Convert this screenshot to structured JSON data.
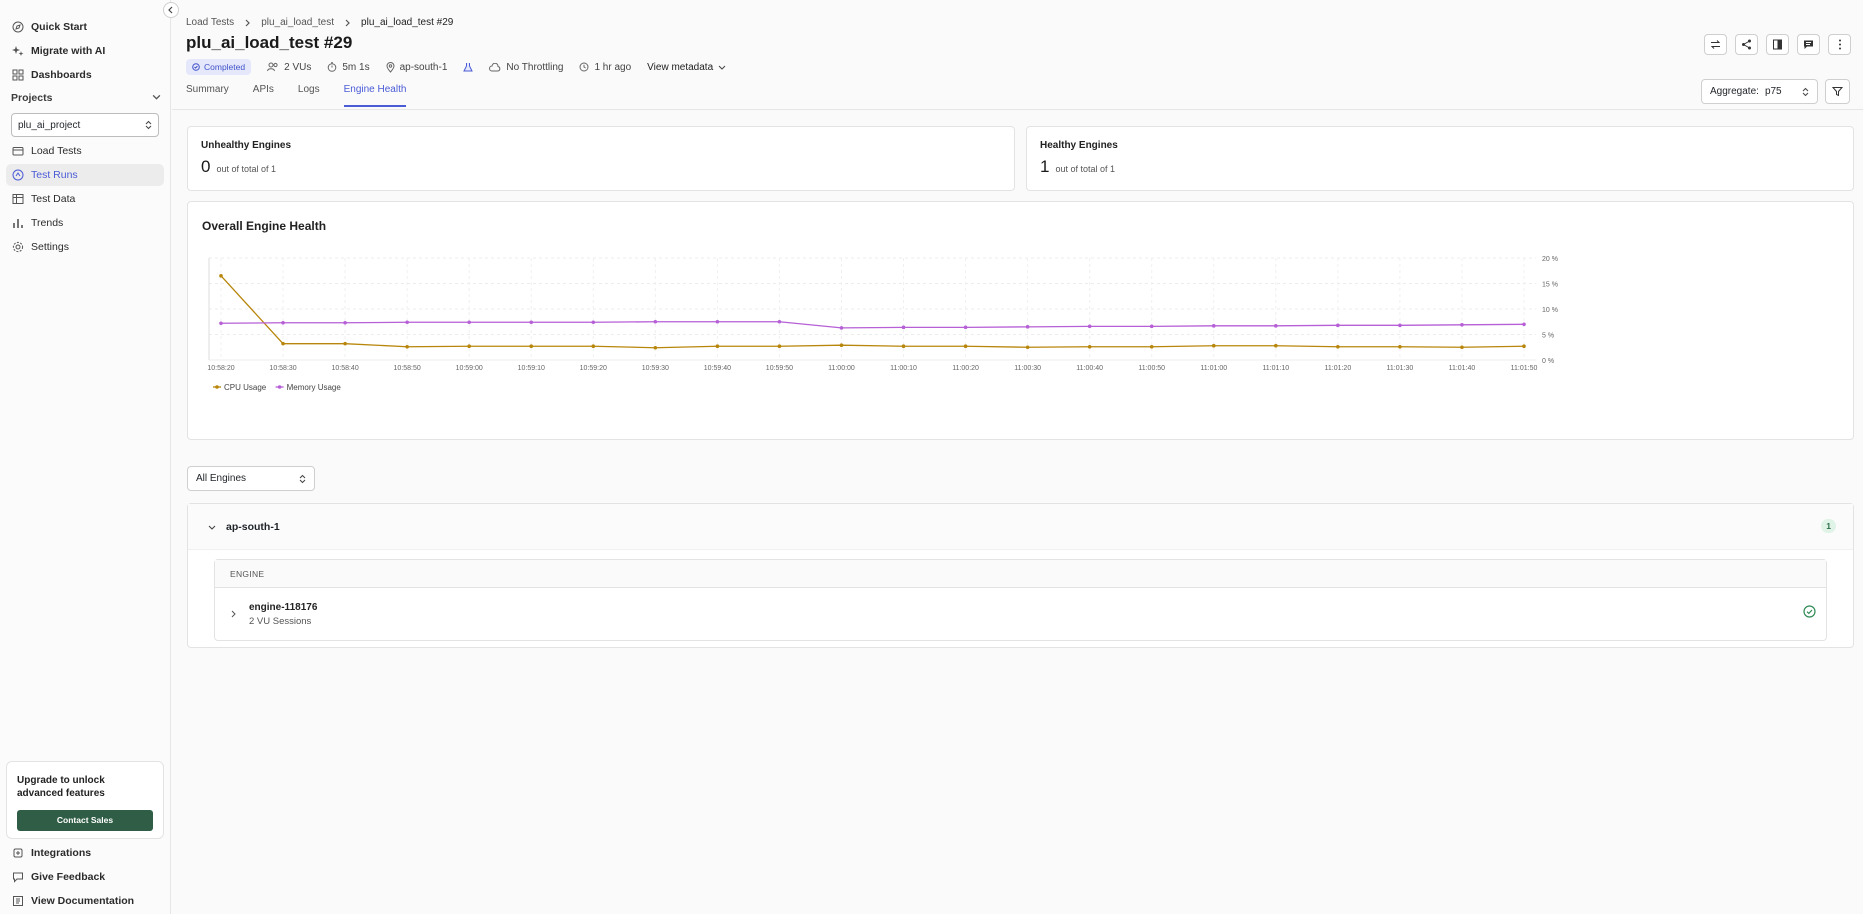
{
  "sidebar": {
    "top_items": [
      {
        "label": "Quick Start",
        "icon": "compass-icon"
      },
      {
        "label": "Migrate with AI",
        "icon": "sparkle-icon"
      },
      {
        "label": "Dashboards",
        "icon": "grid-icon"
      }
    ],
    "projects_label": "Projects",
    "project_selected": "plu_ai_project",
    "project_items": [
      {
        "label": "Load Tests",
        "icon": "folder-icon"
      },
      {
        "label": "Test Runs",
        "icon": "runs-icon",
        "active": true
      },
      {
        "label": "Test Data",
        "icon": "table-icon"
      },
      {
        "label": "Trends",
        "icon": "bar-chart-icon"
      },
      {
        "label": "Settings",
        "icon": "gear-icon"
      }
    ],
    "upgrade_text": "Upgrade to unlock advanced features",
    "contact_label": "Contact Sales",
    "bottom_items": [
      {
        "label": "Integrations",
        "icon": "plug-icon"
      },
      {
        "label": "Give Feedback",
        "icon": "feedback-icon"
      },
      {
        "label": "View Documentation",
        "icon": "doc-icon"
      }
    ]
  },
  "breadcrumb": [
    "Load Tests",
    "plu_ai_load_test",
    "plu_ai_load_test #29"
  ],
  "title": "plu_ai_load_test #29",
  "meta": {
    "status": "Completed",
    "vus": "2 VUs",
    "duration": "5m 1s",
    "region": "ap-south-1",
    "throttling": "No Throttling",
    "time_ago": "1 hr ago",
    "view_metadata": "View metadata"
  },
  "tabs": [
    "Summary",
    "APIs",
    "Logs",
    "Engine Health"
  ],
  "active_tab": "Engine Health",
  "aggregate": {
    "label": "Aggregate:",
    "value": "p75"
  },
  "unhealthy": {
    "label": "Unhealthy Engines",
    "value": "0",
    "sub": "out of total of 1"
  },
  "healthy": {
    "label": "Healthy Engines",
    "value": "1",
    "sub": "out of total of 1"
  },
  "chart_title": "Overall Engine Health",
  "chart_data": {
    "type": "line",
    "title": "Overall Engine Health",
    "x": [
      "10:58:20",
      "10:58:30",
      "10:58:40",
      "10:58:50",
      "10:59:00",
      "10:59:10",
      "10:59:20",
      "10:59:30",
      "10:59:40",
      "10:59:50",
      "11:00:00",
      "11:00:10",
      "11:00:20",
      "11:00:30",
      "11:00:40",
      "11:00:50",
      "11:01:00",
      "11:01:10",
      "11:01:20",
      "11:01:30",
      "11:01:40",
      "11:01:50"
    ],
    "yticks": [
      "0 %",
      "5 %",
      "10 %",
      "15 %",
      "20 %"
    ],
    "ylim": [
      0,
      20
    ],
    "y_axis_side": "right",
    "grid": true,
    "legend_position": "bottom-left",
    "series": [
      {
        "name": "CPU Usage",
        "color": "#b8860b",
        "values": [
          16.5,
          3.2,
          3.2,
          2.6,
          2.7,
          2.7,
          2.7,
          2.4,
          2.7,
          2.7,
          2.9,
          2.7,
          2.7,
          2.5,
          2.6,
          2.6,
          2.8,
          2.8,
          2.6,
          2.6,
          2.5,
          2.7
        ]
      },
      {
        "name": "Memory Usage",
        "color": "#b65fd6",
        "values": [
          7.2,
          7.3,
          7.3,
          7.4,
          7.4,
          7.4,
          7.4,
          7.5,
          7.5,
          7.5,
          6.3,
          6.4,
          6.4,
          6.5,
          6.6,
          6.6,
          6.7,
          6.7,
          6.8,
          6.8,
          6.9,
          7.0
        ]
      }
    ]
  },
  "engines_filter": "All Engines",
  "region_group": {
    "name": "ap-south-1",
    "count": "1"
  },
  "engine_table": {
    "header": "ENGINE",
    "rows": [
      {
        "name": "engine-118176",
        "sub": "2 VU Sessions"
      }
    ]
  }
}
